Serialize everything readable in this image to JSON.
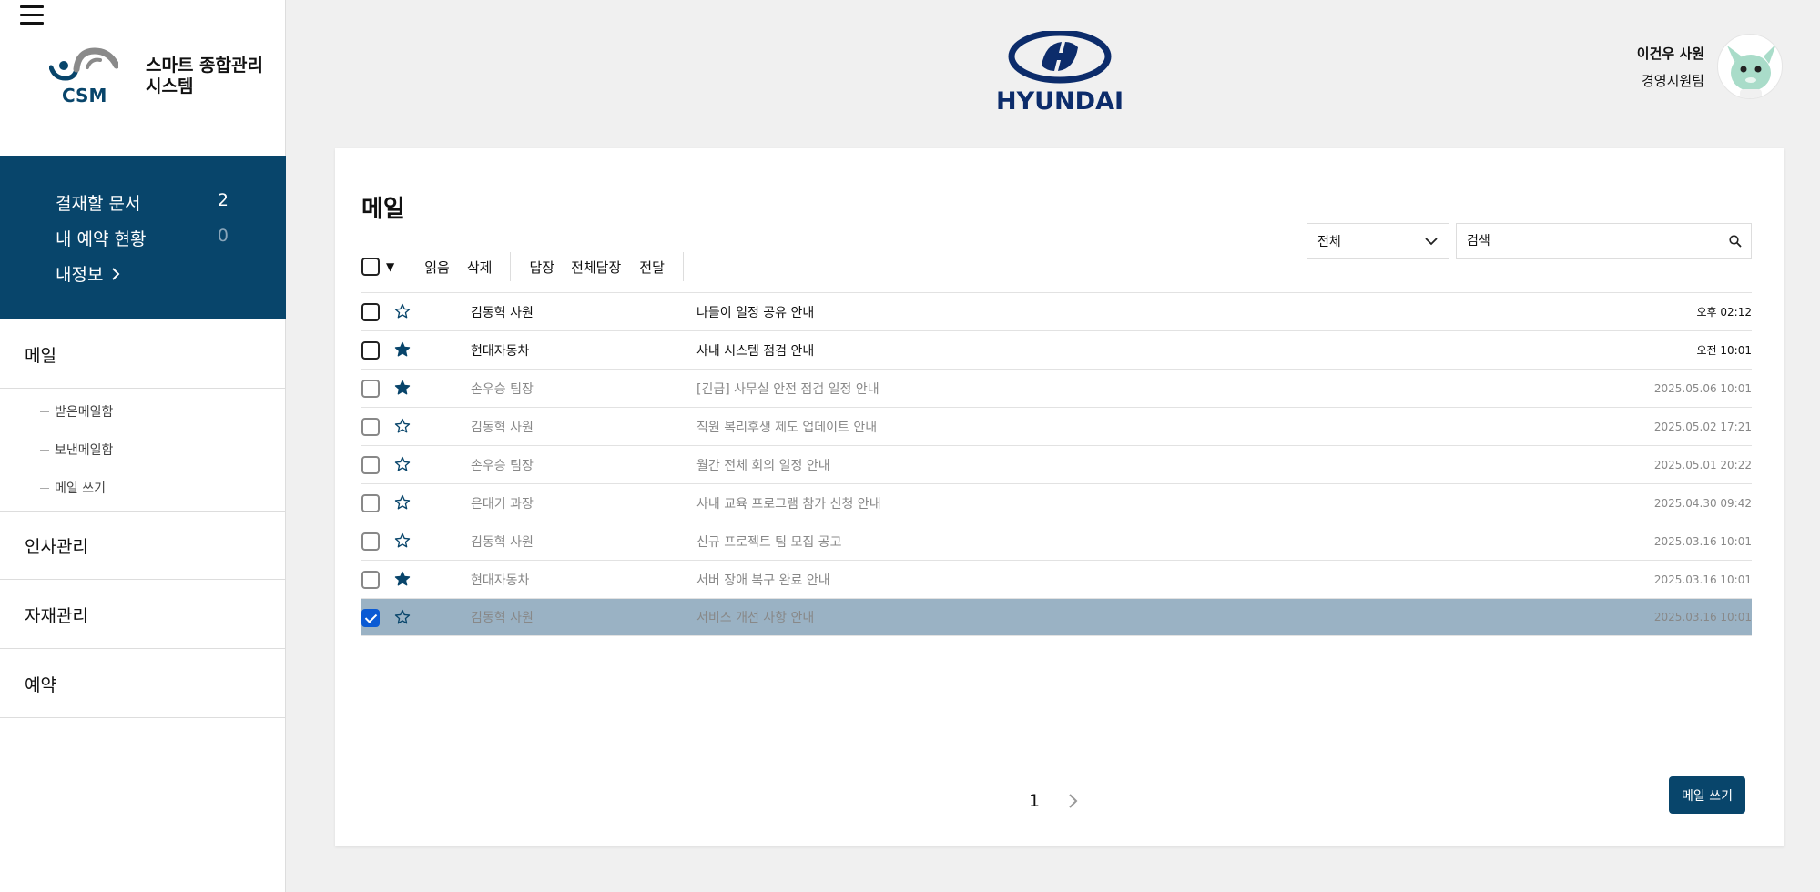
{
  "app": {
    "brand_text": "스마트 종합관리 시스템",
    "logo_text": "CSM",
    "company_logo_text": "HYUNDAI"
  },
  "colors": {
    "primary": "#08456b",
    "selected_row": "#9ab2c4",
    "checkbox_checked": "#0a5ad4",
    "background": "#f0f0f0"
  },
  "summary": {
    "approval_label": "결재할 문서",
    "approval_count": "2",
    "reservation_label": "내 예약 현황",
    "reservation_count": "0",
    "myinfo_label": "내정보"
  },
  "nav": {
    "mail": "메일",
    "mail_sub": [
      "받은메일함",
      "보낸메일함",
      "메일 쓰기"
    ],
    "hr": "인사관리",
    "materials": "자재관리",
    "reservation": "예약"
  },
  "user": {
    "name": "이건우 사원",
    "team": "경영지원팀"
  },
  "mail": {
    "title": "메일",
    "filter_value": "전체",
    "search_placeholder": "검색",
    "toolbar": {
      "read": "읽음",
      "delete": "삭제",
      "reply": "답장",
      "reply_all": "전체답장",
      "forward": "전달"
    },
    "rows": [
      {
        "sender": "김동혁 사원",
        "subject": "나들이 일정 공유 안내",
        "time": "오후 02:12",
        "read": false,
        "starred": false,
        "checked": false
      },
      {
        "sender": "현대자동차",
        "subject": "사내 시스템 점검 안내",
        "time": "오전 10:01",
        "read": false,
        "starred": true,
        "checked": false
      },
      {
        "sender": "손우승 팀장",
        "subject": "[긴급] 사무실 안전 점검 일정 안내",
        "time": "2025.05.06 10:01",
        "read": true,
        "starred": true,
        "checked": false
      },
      {
        "sender": "김동혁 사원",
        "subject": "직원 복리후생 제도 업데이트 안내",
        "time": "2025.05.02 17:21",
        "read": true,
        "starred": false,
        "checked": false
      },
      {
        "sender": "손우승 팀장",
        "subject": "월간 전체 회의 일정 안내",
        "time": "2025.05.01 20:22",
        "read": true,
        "starred": false,
        "checked": false
      },
      {
        "sender": "은대기 과장",
        "subject": "사내 교육 프로그램 참가 신청 안내",
        "time": "2025.04.30 09:42",
        "read": true,
        "starred": false,
        "checked": false
      },
      {
        "sender": "김동혁 사원",
        "subject": "신규 프로젝트 팀 모집 공고",
        "time": "2025.03.16 10:01",
        "read": true,
        "starred": false,
        "checked": false
      },
      {
        "sender": "현대자동차",
        "subject": "서버 장애 복구 완료 안내",
        "time": "2025.03.16 10:01",
        "read": true,
        "starred": true,
        "checked": false
      },
      {
        "sender": "김동혁 사원",
        "subject": "서비스 개선 사항 안내",
        "time": "2025.03.16 10:01",
        "read": true,
        "starred": false,
        "checked": true
      }
    ],
    "page": "1",
    "write_button": "메일 쓰기"
  }
}
